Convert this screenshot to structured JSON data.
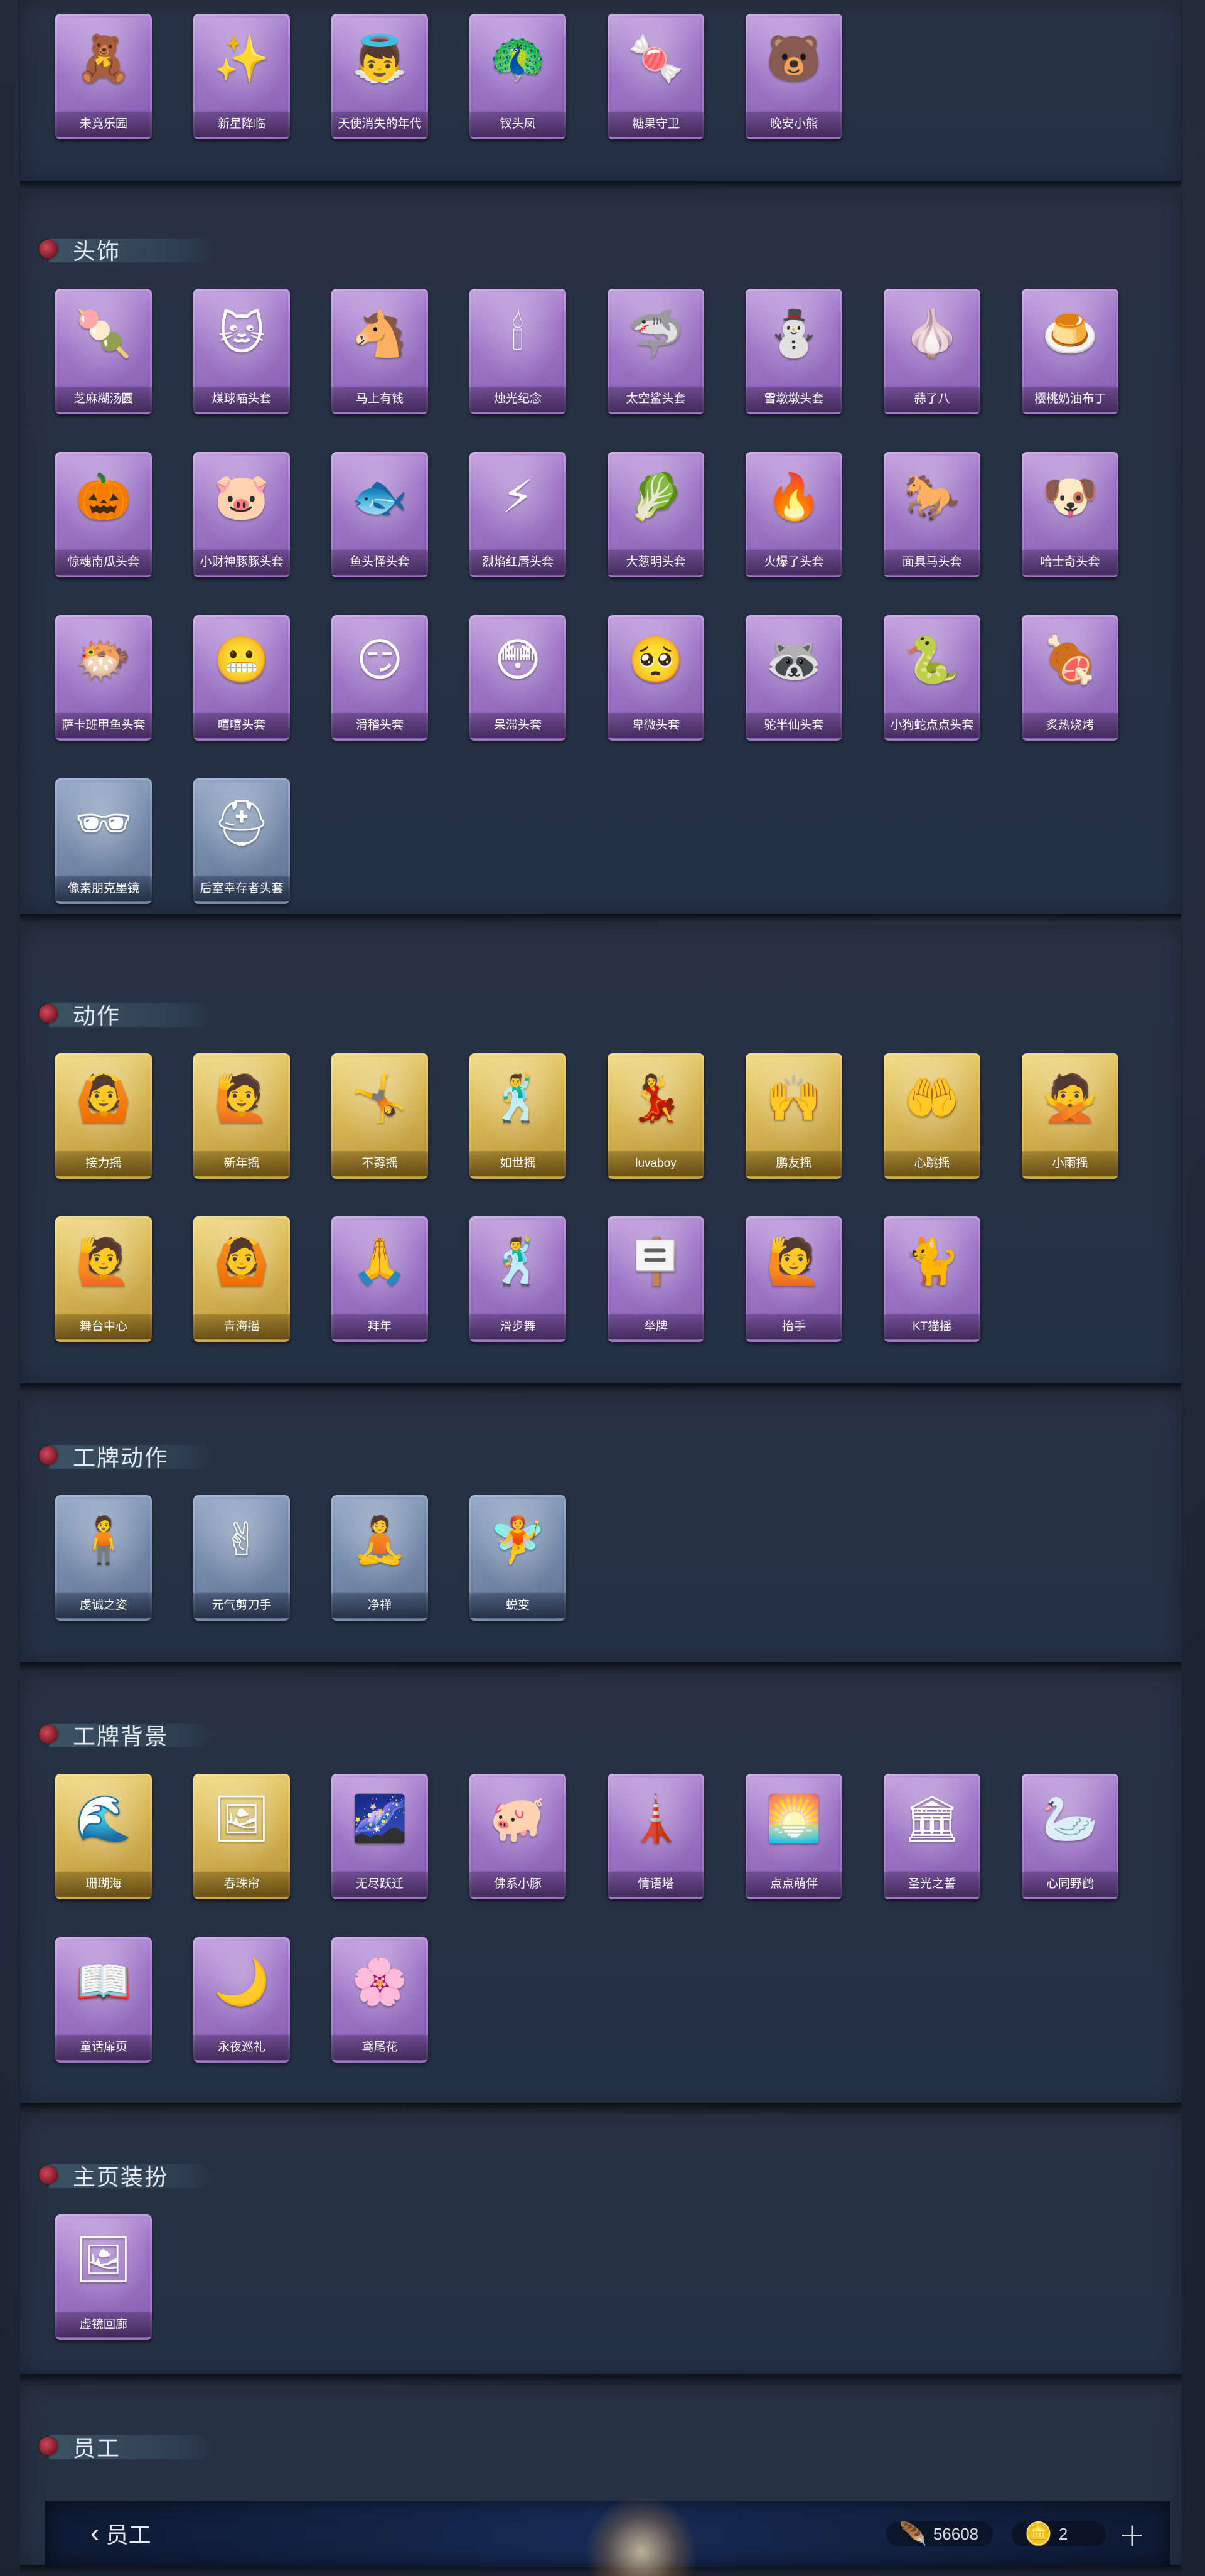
{
  "sections": [
    {
      "key": "top_partial",
      "title": "",
      "cards": [
        {
          "label": "未竟乐园",
          "icon": "doll-icon",
          "glyph": "🧸",
          "color": "purple"
        },
        {
          "label": "新星降临",
          "icon": "charm-icon",
          "glyph": "✨",
          "color": "purple"
        },
        {
          "label": "天使消失的年代",
          "icon": "angel-icon",
          "glyph": "👼",
          "color": "purple"
        },
        {
          "label": "钗头凤",
          "icon": "phoenix-icon",
          "glyph": "🦚",
          "color": "purple"
        },
        {
          "label": "糖果守卫",
          "icon": "candy-icon",
          "glyph": "🍬",
          "color": "purple"
        },
        {
          "label": "晚安小熊",
          "icon": "bear-icon",
          "glyph": "🐻",
          "color": "purple"
        }
      ]
    },
    {
      "key": "head",
      "title": "头饰",
      "cards": [
        {
          "label": "芝麻糊汤圆",
          "icon": "dumpling-icon",
          "glyph": "🍡",
          "color": "purple"
        },
        {
          "label": "煤球喵头套",
          "icon": "cat-icon",
          "glyph": "🐱",
          "color": "purple"
        },
        {
          "label": "马上有钱",
          "icon": "horse-icon",
          "glyph": "🐴",
          "color": "purple"
        },
        {
          "label": "烛光纪念",
          "icon": "candle-icon",
          "glyph": "🕯",
          "color": "purple"
        },
        {
          "label": "太空鲨头套",
          "icon": "shark-icon",
          "glyph": "🦈",
          "color": "purple"
        },
        {
          "label": "雪墩墩头套",
          "icon": "snowman-icon",
          "glyph": "⛄",
          "color": "purple"
        },
        {
          "label": "蒜了八",
          "icon": "garlic-icon",
          "glyph": "🧄",
          "color": "purple"
        },
        {
          "label": "樱桃奶油布丁",
          "icon": "pudding-icon",
          "glyph": "🍮",
          "color": "purple"
        },
        {
          "label": "惊魂南瓜头套",
          "icon": "pumpkin-icon",
          "glyph": "🎃",
          "color": "purple"
        },
        {
          "label": "小财神豚豚头套",
          "icon": "pig-icon",
          "glyph": "🐷",
          "color": "purple"
        },
        {
          "label": "鱼头怪头套",
          "icon": "fish-icon",
          "glyph": "🐟",
          "color": "purple"
        },
        {
          "label": "烈焰红唇头套",
          "icon": "pikachu-icon",
          "glyph": "⚡",
          "color": "purple"
        },
        {
          "label": "大葱明头套",
          "icon": "leek-icon",
          "glyph": "🥬",
          "color": "purple"
        },
        {
          "label": "火爆了头套",
          "icon": "fire-icon",
          "glyph": "🔥",
          "color": "purple"
        },
        {
          "label": "面具马头套",
          "icon": "horse-mask-icon",
          "glyph": "🐎",
          "color": "purple"
        },
        {
          "label": "哈士奇头套",
          "icon": "husky-icon",
          "glyph": "🐶",
          "color": "purple"
        },
        {
          "label": "萨卡班甲鱼头套",
          "icon": "fish-face-icon",
          "glyph": "🐡",
          "color": "purple"
        },
        {
          "label": "嘻嘻头套",
          "icon": "grin-icon",
          "glyph": "😬",
          "color": "purple"
        },
        {
          "label": "滑稽头套",
          "icon": "smirk-icon",
          "glyph": "😏",
          "color": "purple"
        },
        {
          "label": "呆滞头套",
          "icon": "stare-icon",
          "glyph": "😳",
          "color": "purple"
        },
        {
          "label": "卑微头套",
          "icon": "humble-icon",
          "glyph": "🥺",
          "color": "purple"
        },
        {
          "label": "驼半仙头套",
          "icon": "raccoon-icon",
          "glyph": "🦝",
          "color": "purple"
        },
        {
          "label": "小狗蛇点点头套",
          "icon": "snake-dog-icon",
          "glyph": "🐍",
          "color": "purple"
        },
        {
          "label": "炙热烧烤",
          "icon": "bbq-icon",
          "glyph": "🍖",
          "color": "purple"
        },
        {
          "label": "像素朋克墨镜",
          "icon": "sunglasses-icon",
          "glyph": "🕶",
          "color": "blue"
        },
        {
          "label": "后室幸存者头套",
          "icon": "helmet-icon",
          "glyph": "⛑",
          "color": "blue"
        }
      ]
    },
    {
      "key": "action",
      "title": "动作",
      "cards": [
        {
          "label": "接力摇",
          "icon": "pose-icon",
          "glyph": "🙆",
          "color": "gold"
        },
        {
          "label": "新年摇",
          "icon": "pose-icon",
          "glyph": "🙋",
          "color": "gold"
        },
        {
          "label": "不孬摇",
          "icon": "pose-icon",
          "glyph": "🤸",
          "color": "gold"
        },
        {
          "label": "如世摇",
          "icon": "pose-icon",
          "glyph": "🕺",
          "color": "gold"
        },
        {
          "label": "luvaboy",
          "icon": "pose-icon",
          "glyph": "💃",
          "color": "gold"
        },
        {
          "label": "鹏友摇",
          "icon": "pose-icon",
          "glyph": "🙌",
          "color": "gold"
        },
        {
          "label": "心跳摇",
          "icon": "pose-icon",
          "glyph": "🤲",
          "color": "gold"
        },
        {
          "label": "小雨摇",
          "icon": "pose-icon",
          "glyph": "🙅",
          "color": "gold"
        },
        {
          "label": "舞台中心",
          "icon": "pose-icon",
          "glyph": "🙋",
          "color": "gold"
        },
        {
          "label": "青海摇",
          "icon": "pose-icon",
          "glyph": "🙆",
          "color": "gold"
        },
        {
          "label": "拜年",
          "icon": "pose-icon",
          "glyph": "🙏",
          "color": "purple"
        },
        {
          "label": "滑步舞",
          "icon": "pose-icon",
          "glyph": "🕺",
          "color": "purple"
        },
        {
          "label": "举牌",
          "icon": "sign-icon",
          "glyph": "🪧",
          "color": "purple"
        },
        {
          "label": "抬手",
          "icon": "pose-icon",
          "glyph": "🙋",
          "color": "purple"
        },
        {
          "label": "KT猫摇",
          "icon": "pose-icon",
          "glyph": "🐈",
          "color": "purple"
        }
      ]
    },
    {
      "key": "badge_action",
      "title": "工牌动作",
      "cards": [
        {
          "label": "虔诚之姿",
          "icon": "silhouette-icon",
          "glyph": "🧍",
          "color": "blue"
        },
        {
          "label": "元气剪刀手",
          "icon": "silhouette-icon",
          "glyph": "✌",
          "color": "blue"
        },
        {
          "label": "净禅",
          "icon": "silhouette-icon",
          "glyph": "🧘",
          "color": "blue"
        },
        {
          "label": "蜕变",
          "icon": "silhouette-icon",
          "glyph": "🧚",
          "color": "blue"
        }
      ]
    },
    {
      "key": "badge_bg",
      "title": "工牌背景",
      "cards": [
        {
          "label": "珊瑚海",
          "icon": "frame-icon",
          "glyph": "🌊",
          "color": "gold"
        },
        {
          "label": "春珠帘",
          "icon": "frame-icon",
          "glyph": "🖼",
          "color": "gold"
        },
        {
          "label": "无尽跃迁",
          "icon": "frame-icon",
          "glyph": "🌌",
          "color": "purple"
        },
        {
          "label": "佛系小豚",
          "icon": "frame-icon",
          "glyph": "🐖",
          "color": "purple"
        },
        {
          "label": "情语塔",
          "icon": "frame-icon",
          "glyph": "🗼",
          "color": "purple"
        },
        {
          "label": "点点萌伴",
          "icon": "frame-icon",
          "glyph": "🌅",
          "color": "purple"
        },
        {
          "label": "圣光之誓",
          "icon": "frame-icon",
          "glyph": "🏛",
          "color": "purple"
        },
        {
          "label": "心同野鹤",
          "icon": "frame-icon",
          "glyph": "🦢",
          "color": "purple"
        },
        {
          "label": "童话扉页",
          "icon": "frame-icon",
          "glyph": "📖",
          "color": "purple"
        },
        {
          "label": "永夜巡礼",
          "icon": "frame-icon",
          "glyph": "🌙",
          "color": "purple"
        },
        {
          "label": "鸢尾花",
          "icon": "frame-icon",
          "glyph": "🌸",
          "color": "purple"
        }
      ]
    },
    {
      "key": "home",
      "title": "主页装扮",
      "cards": [
        {
          "label": "虚镜回廊",
          "icon": "gallery-icon",
          "glyph": "🖼",
          "color": "purple"
        }
      ]
    },
    {
      "key": "staff",
      "title": "员工",
      "cards": []
    }
  ],
  "staff_bar": {
    "back_label": "员工",
    "currency1_value": "56608",
    "currency1_icon": "feather-token-icon",
    "currency2_value": "2",
    "currency2_icon": "gold-bar-icon",
    "plus_icon": "plus-icon"
  }
}
